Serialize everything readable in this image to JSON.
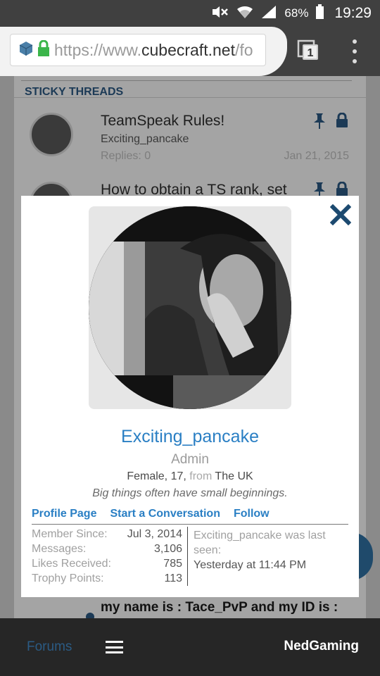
{
  "status_bar": {
    "battery_pct": "68%",
    "clock": "19:29"
  },
  "browser": {
    "url_prefix": "https://www.",
    "url_host": "cubecraft.net",
    "url_suffix": "/fo",
    "tab_count": "1"
  },
  "forum": {
    "section_title": "STICKY THREADS",
    "threads": [
      {
        "title": "TeamSpeak Rules!",
        "author": "Exciting_pancake",
        "replies": "Replies:  0",
        "date": "Jan 21, 2015"
      },
      {
        "title": "How to obtain a TS rank, set"
      }
    ],
    "bottom_thread_title": "my name is : Tace_PvP and my ID is :"
  },
  "profile": {
    "username": "Exciting_pancake",
    "role": "Admin",
    "details_prefix": "Female, 17,",
    "details_from": "from",
    "details_location": "The UK",
    "quote": "Big things often have small beginnings.",
    "links": {
      "profile": "Profile Page",
      "conversation": "Start a Conversation",
      "follow": "Follow"
    },
    "stats": [
      {
        "label": "Member Since:",
        "value": "Jul 3, 2014"
      },
      {
        "label": "Messages:",
        "value": "3,106"
      },
      {
        "label": "Likes Received:",
        "value": "785"
      },
      {
        "label": "Trophy Points:",
        "value": "113"
      }
    ],
    "last_seen_text": "Exciting_pancake was last seen:",
    "last_seen_time": "Yesterday at 11:44 PM"
  },
  "bottom_nav": {
    "forums": "Forums",
    "user": "NedGaming"
  },
  "colors": {
    "link_blue": "#2a7fc4",
    "dark_blue": "#1c3a56",
    "status_bar": "#404040"
  }
}
